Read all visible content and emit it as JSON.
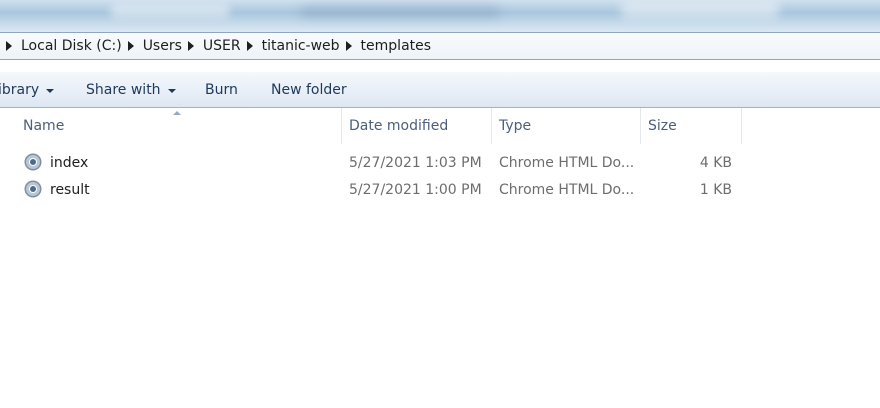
{
  "address_bar": {
    "crumbs": [
      {
        "label": "Local Disk (C:)"
      },
      {
        "label": "Users"
      },
      {
        "label": "USER"
      },
      {
        "label": "titanic-web"
      },
      {
        "label": "templates"
      }
    ]
  },
  "command_bar": {
    "library_label": "ibrary",
    "share_label": "Share with",
    "burn_label": "Burn",
    "new_folder_label": "New folder"
  },
  "columns": {
    "name": "Name",
    "date_modified": "Date modified",
    "type": "Type",
    "size": "Size"
  },
  "files": [
    {
      "name": "index",
      "date": "5/27/2021 1:03 PM",
      "type": "Chrome HTML Do...",
      "size": "4 KB",
      "icon": "chrome-html-file-icon"
    },
    {
      "name": "result",
      "date": "5/27/2021 1:00 PM",
      "type": "Chrome HTML Do...",
      "size": "1 KB",
      "icon": "chrome-html-file-icon"
    }
  ],
  "colors": {
    "header_text": "#4c607a",
    "command_text": "#1e395b",
    "detail_text": "#6d6d6d"
  }
}
